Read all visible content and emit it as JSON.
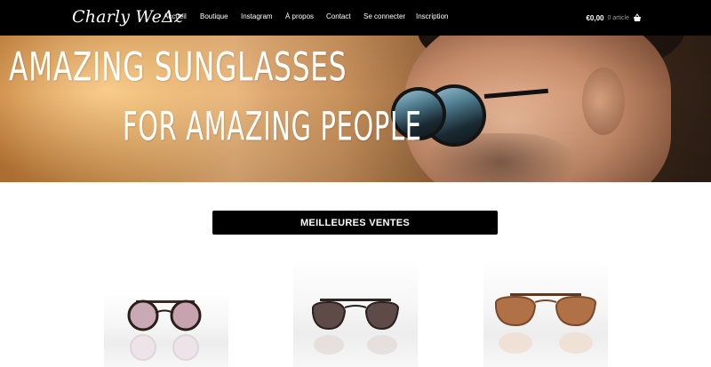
{
  "header": {
    "logo": "Charly WeΔz",
    "nav": [
      {
        "label": "Accueil"
      },
      {
        "label": "Boutique"
      },
      {
        "label": "Instagram"
      },
      {
        "label": "À propos"
      },
      {
        "label": "Contact"
      },
      {
        "label": "Se connecter"
      },
      {
        "label": "Inscription"
      }
    ],
    "cart": {
      "price": "€0,00",
      "count": "0 article",
      "icon": "basket-icon"
    }
  },
  "hero": {
    "line1": "Amazing sunglasses",
    "line2": "for amazing people"
  },
  "section": {
    "title": "MEILLEURES VENTES"
  },
  "products": [
    {
      "name": "round-pink-lens-sunglasses"
    },
    {
      "name": "dark-brow-bar-sunglasses"
    },
    {
      "name": "amber-brow-bar-sunglasses"
    }
  ],
  "colors": {
    "header_bg": "#000000",
    "button_bg": "#000000",
    "text_light": "#ffffff"
  }
}
